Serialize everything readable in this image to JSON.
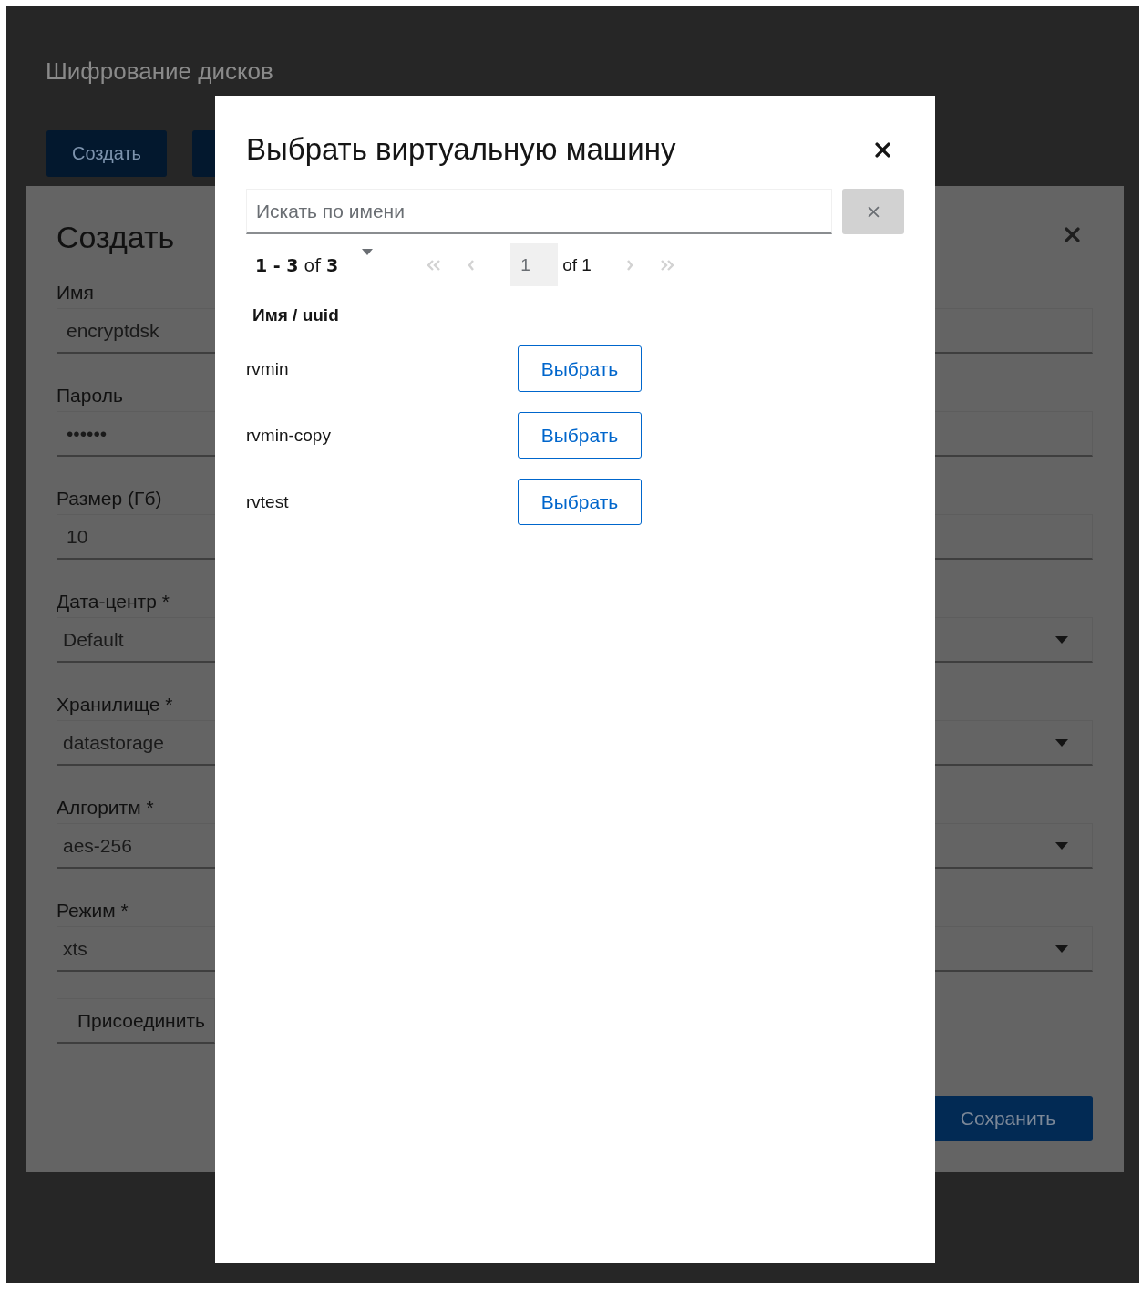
{
  "page": {
    "title": "Шифрование дисков",
    "create_button": "Создать"
  },
  "form": {
    "title": "Создать",
    "fields": [
      {
        "kind": "text",
        "label": "Имя",
        "value": "encryptdsk"
      },
      {
        "kind": "text",
        "label": "Пароль",
        "value": "••••••"
      },
      {
        "kind": "text",
        "label": "Размер (Гб)",
        "value": "10"
      },
      {
        "kind": "select",
        "label": "Дата-центр *",
        "value": "Default"
      },
      {
        "kind": "select",
        "label": "Хранилище *",
        "value": "datastorage"
      },
      {
        "kind": "select",
        "label": "Алгоритм *",
        "value": "aes-256"
      },
      {
        "kind": "select",
        "label": "Режим *",
        "value": "xts"
      }
    ],
    "attach_button": "Присоединить",
    "save_button": "Сохранить"
  },
  "dialog": {
    "title": "Выбрать виртуальную машину",
    "search": {
      "placeholder": "Искать по имени"
    },
    "pagination": {
      "range": "**1 - 3** of **3**",
      "page": "1",
      "of_pages": "of 1"
    },
    "column": "Имя / uuid",
    "rows": [
      {
        "name": "rvmin",
        "action": "Выбрать"
      },
      {
        "name": "rvmin-copy",
        "action": "Выбрать"
      },
      {
        "name": "rvtest",
        "action": "Выбрать"
      }
    ]
  }
}
